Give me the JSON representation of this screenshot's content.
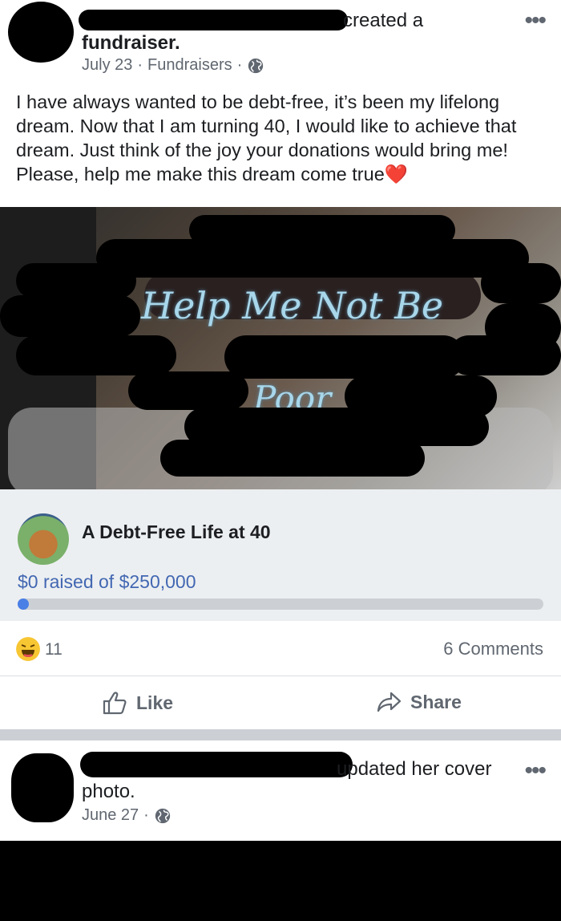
{
  "post1": {
    "header_suffix": "created a",
    "header_line2": "fundraiser.",
    "date": "July 23",
    "category": "Fundraisers",
    "separator": "·",
    "body": "I have always wanted to be debt-free, it’s been my lifelong dream. Now that I am turning 40, I would like to achieve that dream. Just think of the joy your donations would bring me! Please, help me make this dream come true",
    "heart_emoji": "❤️",
    "photo_text_line1": "Help Me Not Be",
    "photo_text_line2": "Poor"
  },
  "fundraiser": {
    "title": "A Debt-Free Life at 40",
    "raised": "$0 raised of $250,000",
    "progress_fraction": 0.0
  },
  "engagement": {
    "reaction_count": "11",
    "comments": "6 Comments"
  },
  "actions": {
    "like": "Like",
    "share": "Share"
  },
  "post2": {
    "header_suffix": "updated her cover",
    "header_line2": "photo.",
    "date": "June 27",
    "separator": "·"
  },
  "icons": {
    "more": "more-options-icon",
    "globe": "globe-icon",
    "like": "thumbs-up-icon",
    "share": "share-arrow-icon",
    "haha": "haha-reaction-icon"
  },
  "colors": {
    "link_blue": "#4267b2",
    "progress": "#4a7fe5",
    "reaction_yellow": "#f7c633"
  }
}
